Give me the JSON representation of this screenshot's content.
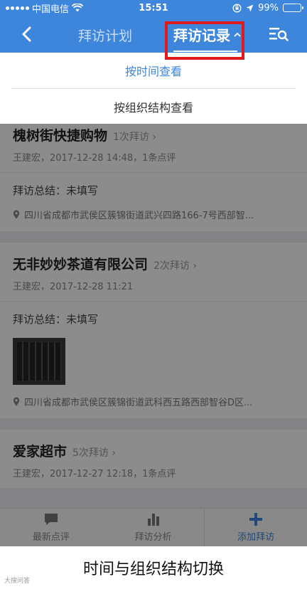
{
  "status_bar": {
    "carrier": "中国电信",
    "time": "15:51",
    "battery": "99%",
    "battery_level": 0.99
  },
  "header": {
    "tab_plan": "拜访计划",
    "tab_records": "拜访记录",
    "tab_records_arrow": "^",
    "back_icon": "chevron-left-icon",
    "filter_icon": "list-search-icon"
  },
  "dropdown": {
    "by_time": "按时间查看",
    "by_org": "按组织结构查看"
  },
  "visits": [
    {
      "shop": "槐树街快捷购物",
      "count": "1次拜访",
      "meta": "王建宏，2017-12-28 14:48，1条点评",
      "summary": "拜访总结：未填写",
      "address": "四川省成都市武侯区簇锦街道武兴四路166-7号西部智..."
    },
    {
      "shop": "无非妙妙茶道有限公司",
      "count": "2次拜访",
      "meta": "王建宏，2017-12-28 11:21",
      "summary": "拜访总结：未填写",
      "address": "四川省成都市武侯区簇锦街道武科西五路西部智谷D区..."
    },
    {
      "shop": "爱家超市",
      "count": "5次拜访",
      "meta": "王建宏，2017-12-27 12:18，1条点评"
    }
  ],
  "tabbar": {
    "latest_comments": "最新点评",
    "visit_analysis": "拜访分析",
    "add_visit": "添加拜访"
  },
  "caption": "时间与组织结构切换",
  "watermark": "大搜问答",
  "colors": {
    "primary": "#3e86dc",
    "highlight": "#e01a1a"
  }
}
